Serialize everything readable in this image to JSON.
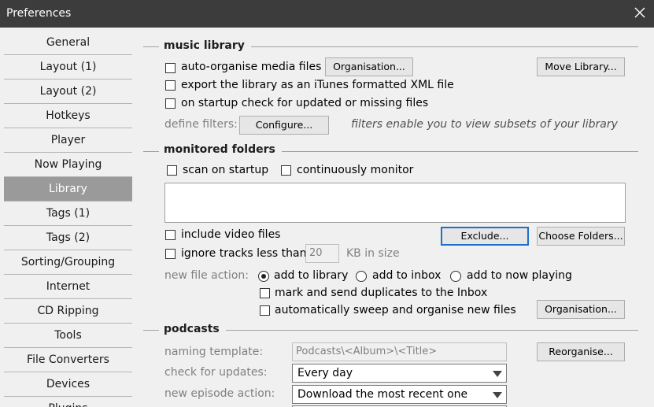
{
  "window": {
    "title": "Preferences"
  },
  "sidebar": {
    "items": [
      {
        "label": "General"
      },
      {
        "label": "Layout (1)"
      },
      {
        "label": "Layout (2)"
      },
      {
        "label": "Hotkeys"
      },
      {
        "label": "Player"
      },
      {
        "label": "Now Playing"
      },
      {
        "label": "Library"
      },
      {
        "label": "Tags (1)"
      },
      {
        "label": "Tags (2)"
      },
      {
        "label": "Sorting/Grouping"
      },
      {
        "label": "Internet"
      },
      {
        "label": "CD Ripping"
      },
      {
        "label": "Tools"
      },
      {
        "label": "File Converters"
      },
      {
        "label": "Devices"
      },
      {
        "label": "Plugins"
      }
    ],
    "active": "Library"
  },
  "music_library": {
    "title": "music library",
    "auto_organise": "auto-organise media files",
    "organisation_btn": "Organisation...",
    "move_library_btn": "Move Library...",
    "export_xml": "export the library as an iTunes formatted XML file",
    "startup_check": "on startup check for updated or missing files",
    "define_filters": "define filters:",
    "configure_btn": "Configure...",
    "filters_hint": "filters enable you to view subsets of your library"
  },
  "monitored_folders": {
    "title": "monitored folders",
    "scan_on_startup": "scan on startup",
    "continuously_monitor": "continuously monitor",
    "include_video": "include video files",
    "exclude_btn": "Exclude...",
    "choose_folders_btn": "Choose Folders...",
    "ignore_tracks": "ignore tracks less than",
    "ignore_value": "20",
    "ignore_unit": "KB in size",
    "new_file_action": "new file action:",
    "add_to_library": "add to library",
    "add_to_inbox": "add to inbox",
    "add_to_now_playing": "add to now playing",
    "mark_duplicates": "mark and send duplicates to the Inbox",
    "auto_sweep": "automatically sweep and organise new files",
    "organisation_btn": "Organisation..."
  },
  "podcasts": {
    "title": "podcasts",
    "naming_template_label": "naming template:",
    "naming_template_value": "Podcasts\\<Album>\\<Title>",
    "reorganise_btn": "Reorganise...",
    "check_updates_label": "check for updates:",
    "check_updates_value": "Every day",
    "new_episode_label": "new episode action:",
    "new_episode_value": "Download the most recent one"
  }
}
